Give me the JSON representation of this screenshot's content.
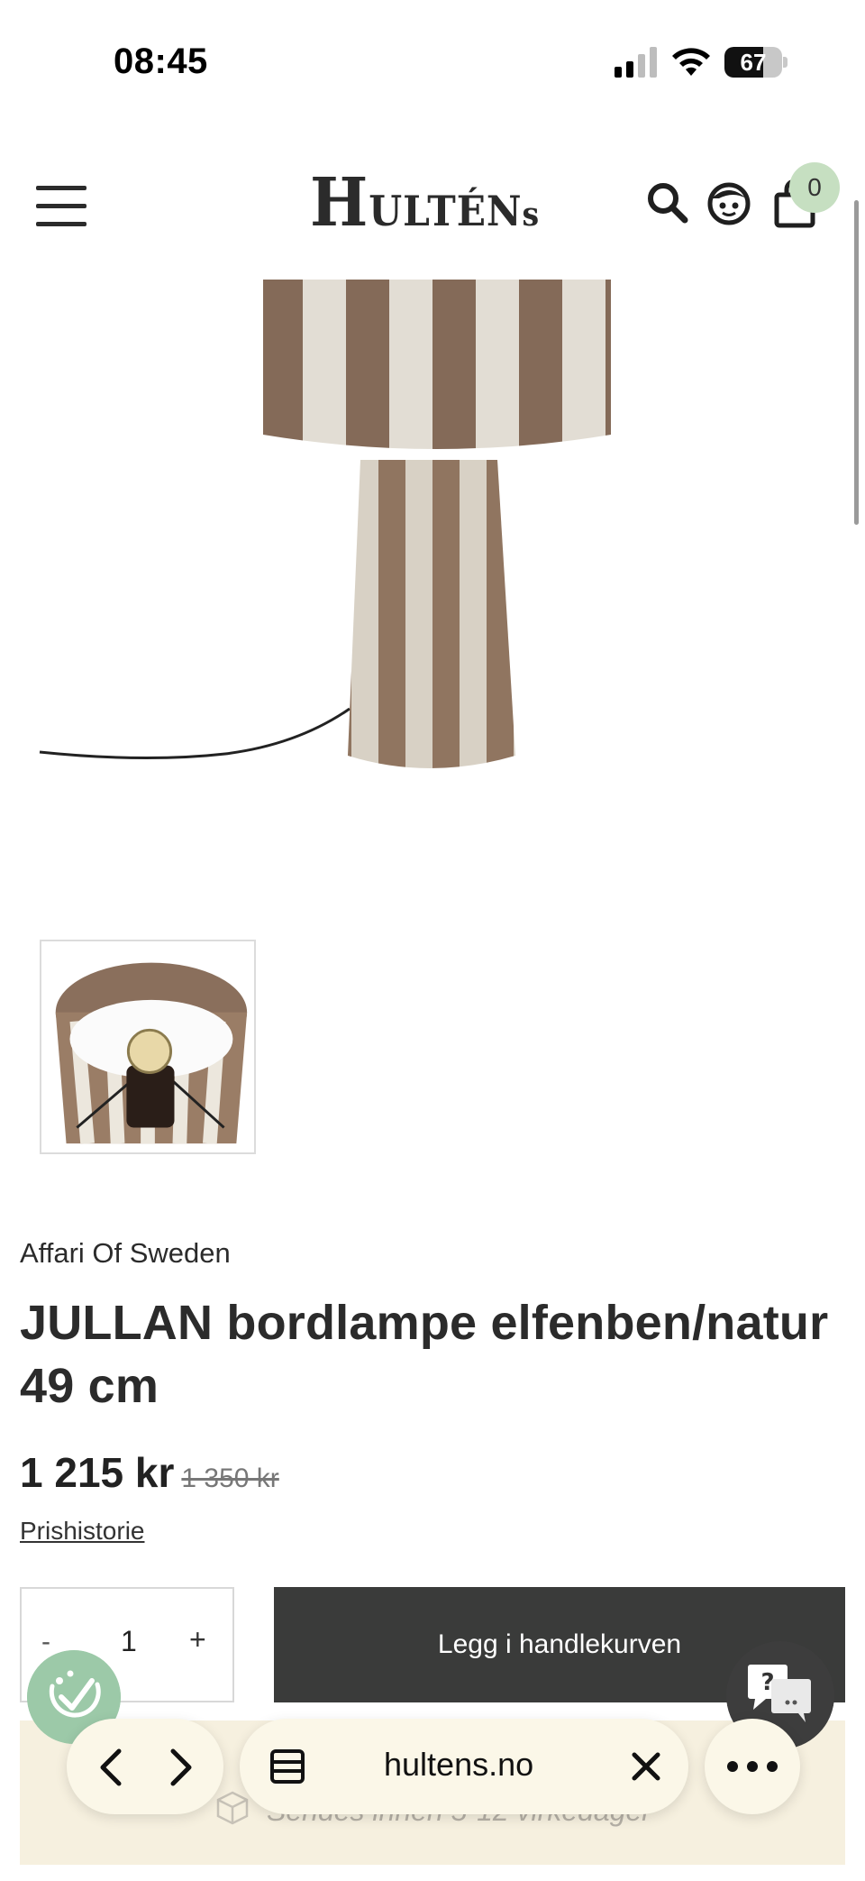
{
  "status_bar": {
    "time": "08:45",
    "battery": "67"
  },
  "header": {
    "logo": {
      "big1": "H",
      "small1": "ULT",
      "big2": "É",
      "small2": "N",
      "tail": "s"
    },
    "cart_count": "0",
    "icons": {
      "menu": "hamburger-menu-icon",
      "search": "search-icon",
      "account": "account-face-icon",
      "cart": "shopping-bag-icon"
    }
  },
  "product": {
    "brand": "Affari Of Sweden",
    "title": "JULLAN bordlampe elfenben/natur 49 cm",
    "price": "1 215 kr",
    "old_price": "1 350 kr",
    "price_history_link": "Prishistorie",
    "quantity": {
      "minus": "-",
      "value": "1",
      "plus": "+"
    },
    "add_to_cart": "Legg i handlekurven",
    "shipping": "Sendes innen 5-12 virkedager"
  },
  "browser": {
    "url": "hultens.no"
  },
  "colors": {
    "add_to_cart_bg": "#3a3b3a",
    "cart_badge_bg": "#c6dfc1",
    "shipping_band_bg": "#f6f0df",
    "cookie_btn_bg": "#9cc9a8"
  }
}
